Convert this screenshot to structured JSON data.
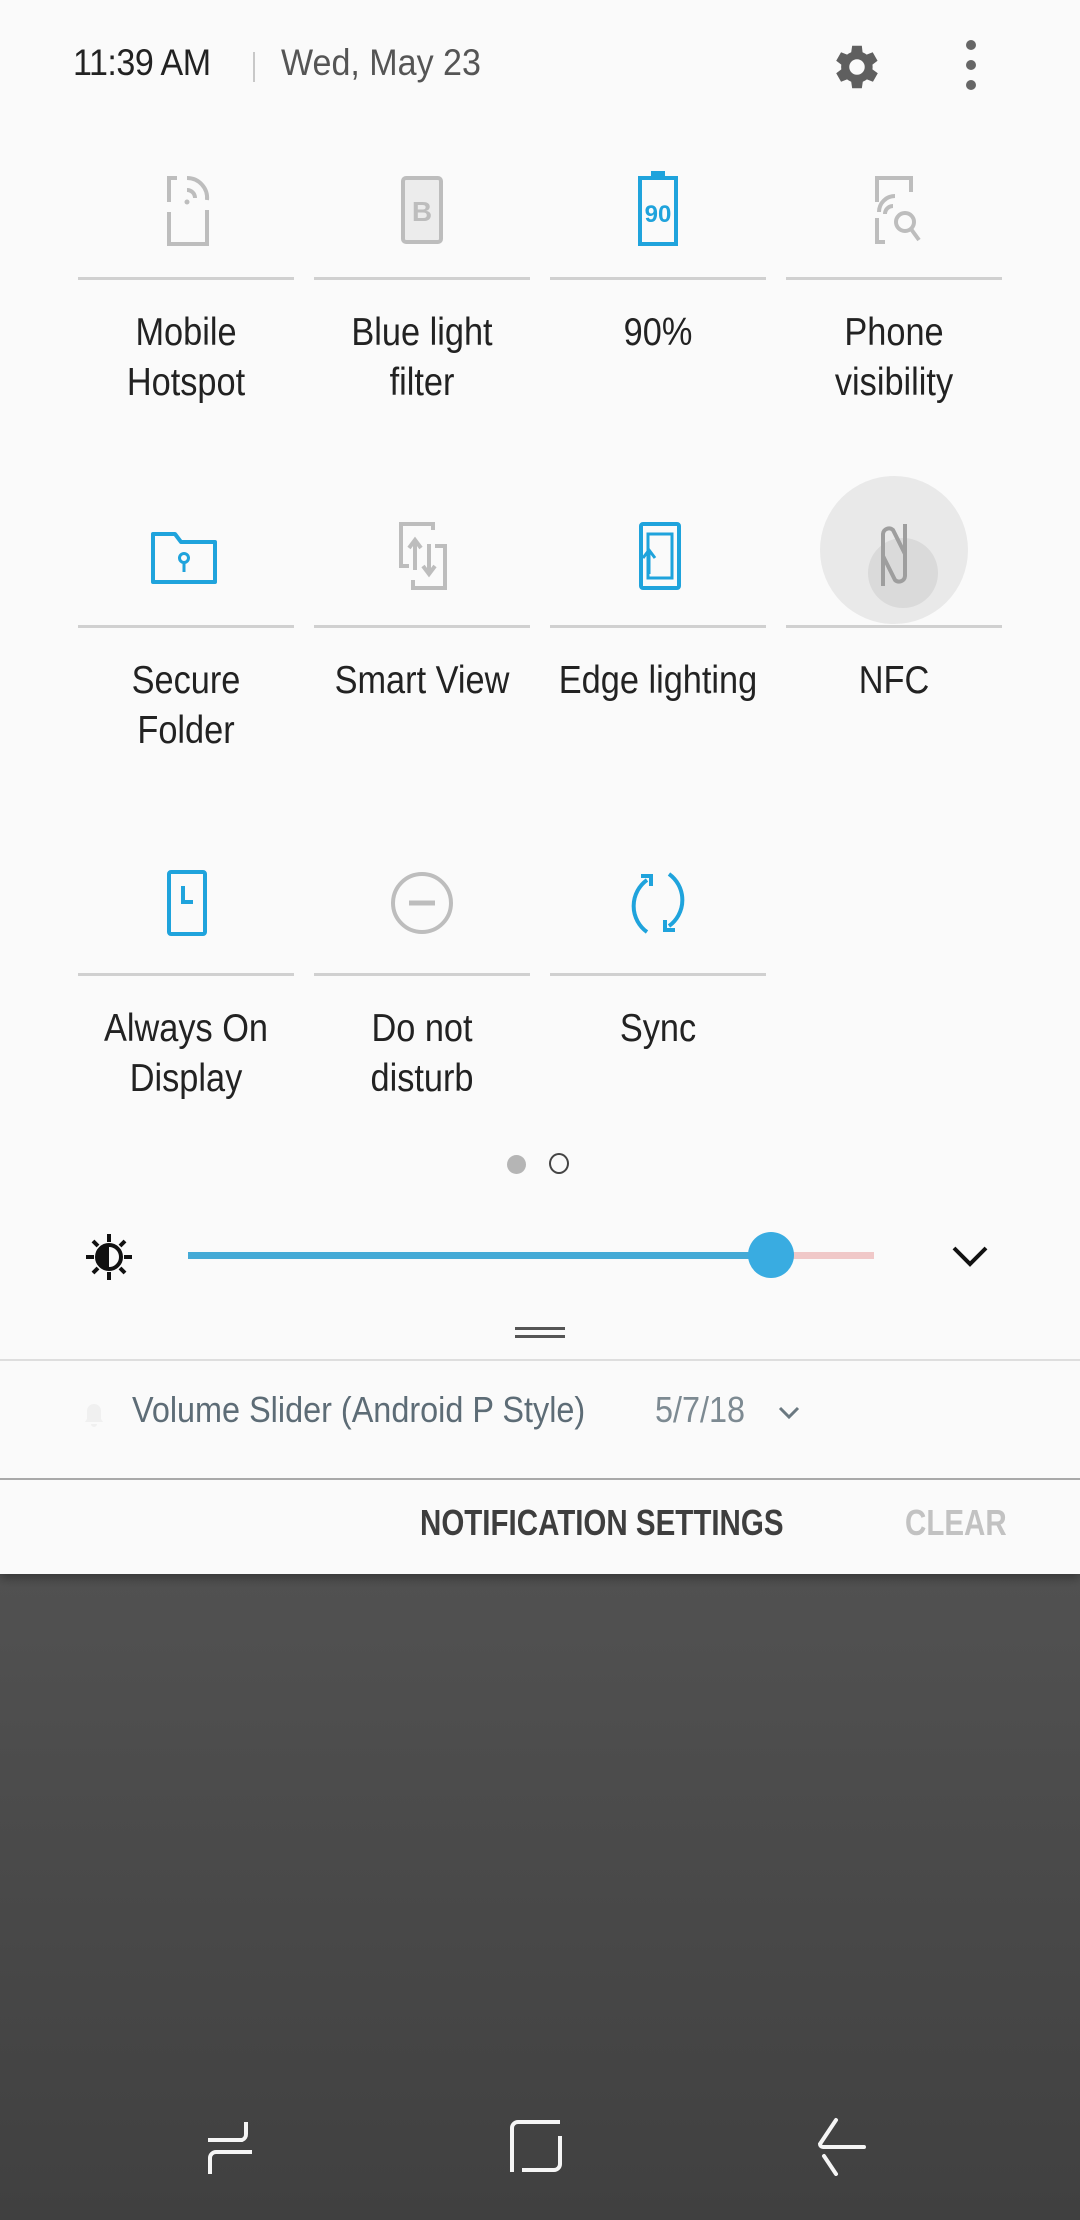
{
  "header": {
    "time": "11:39 AM",
    "date": "Wed, May 23",
    "settings_icon": "gear-icon",
    "more_icon": "more-vertical-icon"
  },
  "colors": {
    "accent_active": "#1fa3dc",
    "icon_inactive": "#bdbdbd",
    "panel_bg": "#fafafa",
    "slider_fill": "#44aad6",
    "slider_rest": "#f0c8c8"
  },
  "quick_settings": {
    "tiles": [
      {
        "label": "Mobile\nHotspot",
        "icon": "mobile-hotspot-icon",
        "active": false
      },
      {
        "label": "Blue light\nfilter",
        "icon": "blue-light-filter-icon",
        "active": false
      },
      {
        "label": "90%",
        "icon": "battery-icon",
        "icon_text": "90",
        "active": true
      },
      {
        "label": "Phone\nvisibility",
        "icon": "phone-visibility-icon",
        "active": false
      },
      {
        "label": "Secure\nFolder",
        "icon": "secure-folder-icon",
        "active": true
      },
      {
        "label": "Smart View",
        "icon": "smart-view-icon",
        "active": false
      },
      {
        "label": "Edge lighting",
        "icon": "edge-lighting-icon",
        "active": true
      },
      {
        "label": "NFC",
        "icon": "nfc-icon",
        "active": false,
        "pressed": true
      },
      {
        "label": "Always On\nDisplay",
        "icon": "always-on-display-icon",
        "active": true
      },
      {
        "label": "Do not\ndisturb",
        "icon": "do-not-disturb-icon",
        "active": false
      },
      {
        "label": "Sync",
        "icon": "sync-icon",
        "active": true
      }
    ],
    "pages": {
      "current": 1,
      "total": 2
    }
  },
  "brightness": {
    "icon": "brightness-icon",
    "level": 0.85,
    "expand_icon": "chevron-down-icon"
  },
  "notification": {
    "app_icon": "bell-icon",
    "title": "Volume Slider (Android P Style)",
    "time": "5/7/18",
    "expand_icon": "chevron-down-icon"
  },
  "actions": {
    "notification_settings": "NOTIFICATION SETTINGS",
    "clear": "CLEAR"
  },
  "navbar": {
    "recents_icon": "recents-icon",
    "home_icon": "home-icon",
    "back_icon": "back-icon"
  }
}
